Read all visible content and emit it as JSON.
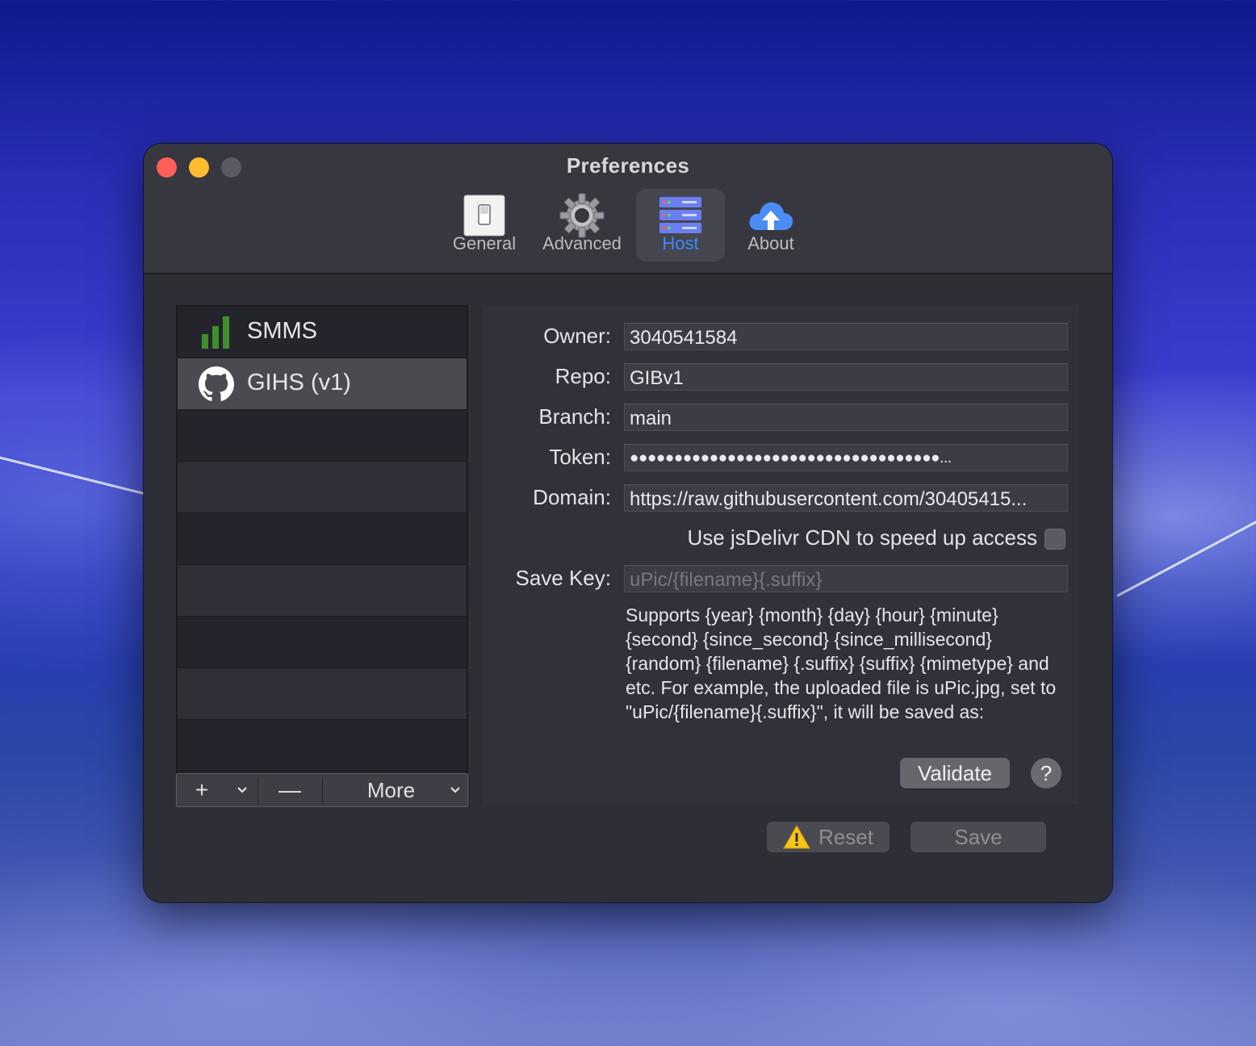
{
  "window": {
    "title": "Preferences"
  },
  "toolbar": {
    "tabs": [
      {
        "label": "General",
        "icon": "switch-icon",
        "selected": false
      },
      {
        "label": "Advanced",
        "icon": "gear-icon",
        "selected": false
      },
      {
        "label": "Host",
        "icon": "server-rack-icon",
        "selected": true
      },
      {
        "label": "About",
        "icon": "cloud-upload-icon",
        "selected": false
      }
    ]
  },
  "hosts": {
    "items": [
      {
        "label": "SMMS",
        "icon": "signal-bars-icon",
        "selected": false
      },
      {
        "label": "GIHS (v1)",
        "icon": "github-icon",
        "selected": true
      }
    ],
    "add_label": "+",
    "remove_label": "—",
    "more_label": "More"
  },
  "form": {
    "owner_label": "Owner:",
    "owner_value": "3040541584",
    "repo_label": "Repo:",
    "repo_value": "GIBv1",
    "branch_label": "Branch:",
    "branch_value": "main",
    "token_label": "Token:",
    "token_value": "●●●●●●●●●●●●●●●●●●●●●●●●●●●●●●●●●●●...",
    "domain_label": "Domain:",
    "domain_value": "https://raw.githubusercontent.com/30405415...",
    "cdn_label": "Use jsDelivr CDN to speed up access",
    "cdn_checked": false,
    "savekey_label": "Save Key:",
    "savekey_placeholder": "uPic/{filename}{.suffix}",
    "help_text": "Supports {year} {month} {day} {hour} {minute} {second} {since_second} {since_millisecond} {random} {filename} {.suffix} {suffix} {mimetype} and etc. For example, the uploaded file is uPic.jpg, set to \"uPic/{filename}{.suffix}\", it will be saved as:",
    "validate_label": "Validate",
    "help_button_label": "?"
  },
  "footer": {
    "reset_label": "Reset",
    "save_label": "Save"
  },
  "colors": {
    "accent": "#3d8bff",
    "close": "#fe5f57",
    "minimize": "#febc2e",
    "window_bg": "#2d2e36"
  }
}
